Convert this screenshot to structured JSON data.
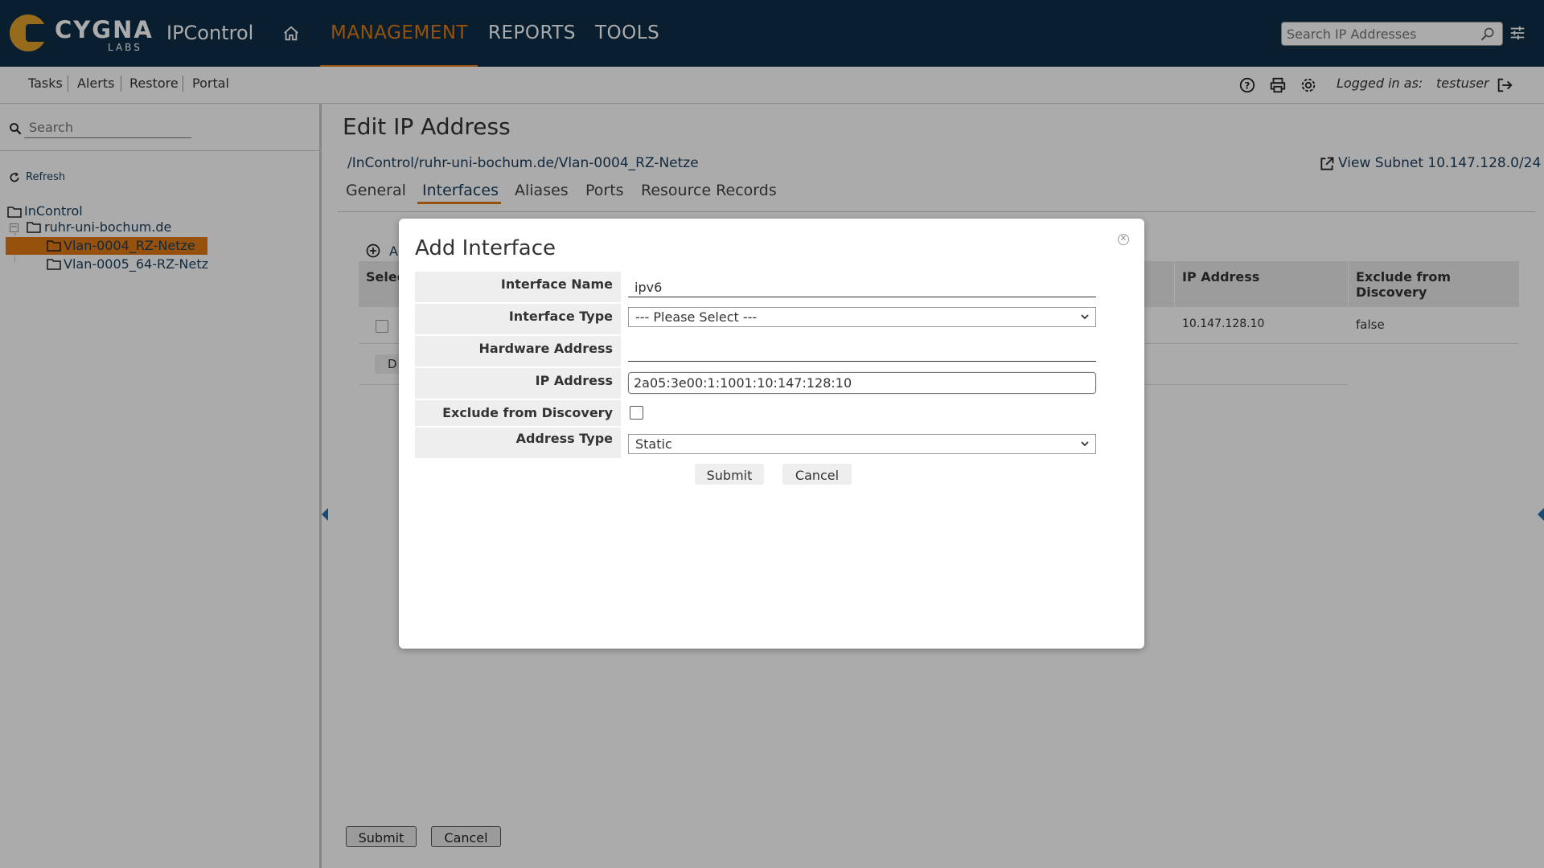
{
  "brand": {
    "logo_text": "CYGNA",
    "logo_sub": "LABS",
    "app_name": "IPControl"
  },
  "nav": {
    "items": [
      "MANAGEMENT",
      "REPORTS",
      "TOOLS"
    ],
    "active": "MANAGEMENT",
    "accent": "#e07a12"
  },
  "top_search": {
    "placeholder": "Search IP Addresses"
  },
  "subnav": {
    "links": [
      "Tasks",
      "Alerts",
      "Restore",
      "Portal"
    ],
    "logged_in_label": "Logged in as:",
    "username": "testuser"
  },
  "sidebar": {
    "search_placeholder": "Search",
    "refresh_label": "Refresh",
    "tree": [
      {
        "label": "InControl"
      },
      {
        "label": "ruhr-uni-bochum.de"
      },
      {
        "label": "Vlan-0004_RZ-Netze",
        "selected": true
      },
      {
        "label": "Vlan-0005_64-RZ-Netz"
      }
    ]
  },
  "main": {
    "title": "Edit IP Address",
    "breadcrumb": "/InControl/ruhr-uni-bochum.de/Vlan-0004_RZ-Netze",
    "view_subnet": "View Subnet 10.147.128.0/24",
    "tabs": [
      "General",
      "Interfaces",
      "Aliases",
      "Ports",
      "Resource Records"
    ],
    "active_tab": "Interfaces",
    "bg_add_label": "A",
    "bg_table": {
      "col_select": "Selec",
      "col_ip": "IP Address",
      "col_exclude": "Exclude from Discovery",
      "row": {
        "ip": "10.147.128.10",
        "exclude": "false"
      },
      "delete_label": "D"
    },
    "submit_label": "Submit",
    "cancel_label": "Cancel"
  },
  "modal": {
    "title": "Add Interface",
    "fields": {
      "interface_name_label": "Interface Name",
      "interface_name_value": "ipv6",
      "interface_type_label": "Interface Type",
      "interface_type_value": "--- Please Select ---",
      "hardware_address_label": "Hardware Address",
      "hardware_address_value": "",
      "ip_address_label": "IP Address",
      "ip_address_value": "2a05:3e00:1:1001:10:147:128:10",
      "exclude_label": "Exclude from Discovery",
      "exclude_checked": false,
      "address_type_label": "Address Type",
      "address_type_value": "Static"
    },
    "submit_label": "Submit",
    "cancel_label": "Cancel"
  }
}
